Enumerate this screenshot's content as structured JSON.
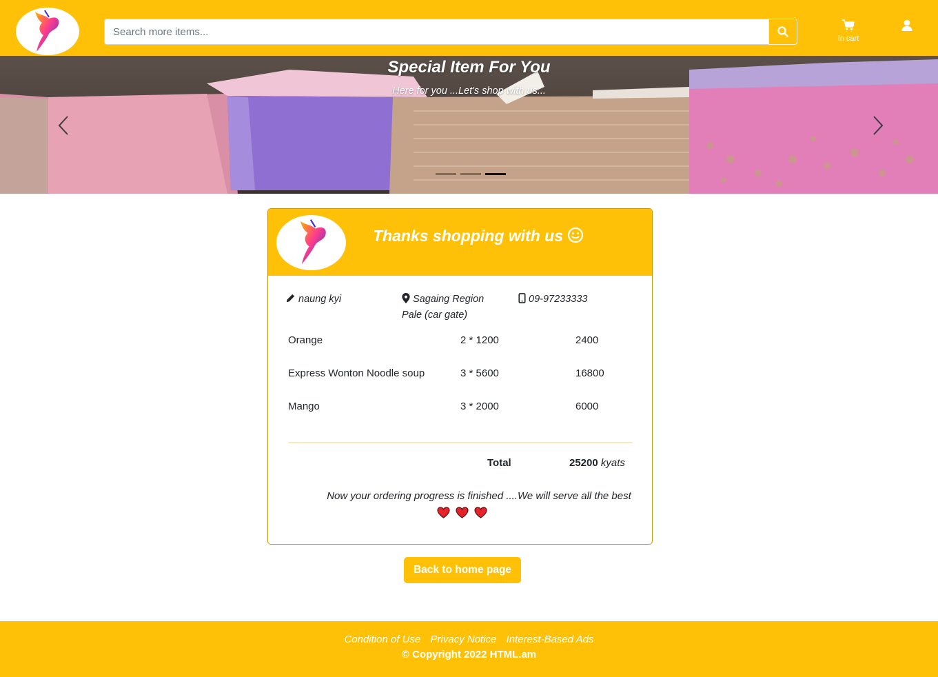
{
  "header": {
    "search_placeholder": "Search more items...",
    "cart_label": "In cart"
  },
  "carousel": {
    "title": "Special Item For You",
    "subtitle": "Here for you ...Let's shop with us...",
    "slide_count": 3,
    "active_slide": 3
  },
  "order": {
    "heading": "Thanks shopping with us",
    "customer_name": "naung kyi",
    "region": "Sagaing Region",
    "address": "Pale (car gate)",
    "phone": "09-97233333",
    "items": [
      {
        "name": "Orange",
        "qty_price": "2 * 1200",
        "amount": "2400"
      },
      {
        "name": "Express Wonton Noodle soup",
        "qty_price": "3 * 5600",
        "amount": "16800"
      },
      {
        "name": "Mango",
        "qty_price": "3 * 2000",
        "amount": "6000"
      }
    ],
    "total_label": "Total",
    "total_value": "25200",
    "currency": "kyats",
    "finish_message": "Now your ordering progress is finished ....We will serve all the best"
  },
  "back_button_label": "Back to home page",
  "footer": {
    "links": [
      "Condition of Use",
      "Privacy Notice",
      "Interest-Based Ads"
    ],
    "copyright": "© Copyright 2022 HTML.am"
  },
  "colors": {
    "accent": "#ffc107",
    "text": "#212529",
    "heart": "#e3242b"
  },
  "icons": [
    "logo-icon",
    "search-icon",
    "cart-icon",
    "user-icon",
    "pencil-icon",
    "location-pin-icon",
    "mobile-phone-icon",
    "smiley-icon",
    "heart-icon",
    "chevron-left-icon",
    "chevron-right-icon"
  ]
}
